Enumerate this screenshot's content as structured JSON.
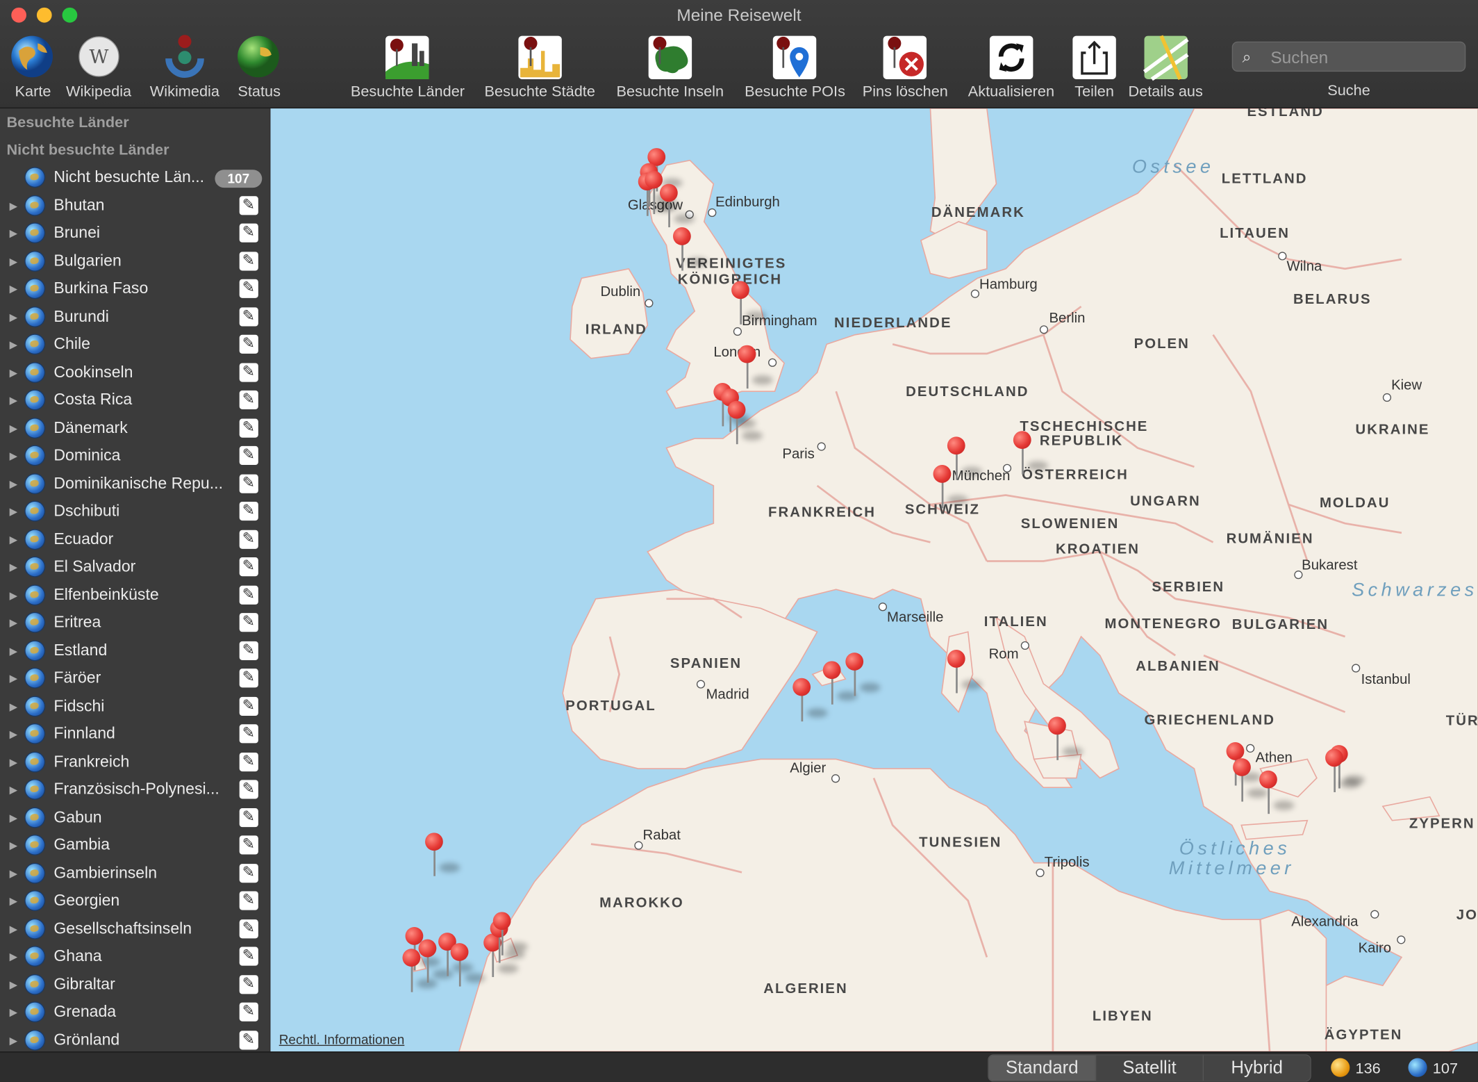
{
  "window": {
    "title": "Meine Reisewelt"
  },
  "toolbar": {
    "left": [
      {
        "label": "Karte",
        "icon": "globe-icon"
      },
      {
        "label": "Wikipedia",
        "icon": "wikipedia-icon"
      },
      {
        "label": "Wikimedia",
        "icon": "wikimedia-icon"
      },
      {
        "label": "Status",
        "icon": "status-globe-icon"
      }
    ],
    "center": [
      {
        "label": "Besuchte Länder",
        "icon": "visited-countries-icon"
      },
      {
        "label": "Besuchte Städte",
        "icon": "visited-cities-icon"
      },
      {
        "label": "Besuchte Inseln",
        "icon": "visited-islands-icon"
      },
      {
        "label": "Besuchte POIs",
        "icon": "visited-pois-icon"
      },
      {
        "label": "Pins löschen",
        "icon": "delete-pins-icon"
      },
      {
        "label": "Aktualisieren",
        "icon": "refresh-icon"
      },
      {
        "label": "Teilen",
        "icon": "share-icon"
      },
      {
        "label": "Details aus",
        "icon": "details-icon"
      }
    ],
    "search": {
      "placeholder": "Suchen",
      "label": "Suche"
    }
  },
  "sidebar": {
    "section_visited": "Besuchte Länder",
    "section_unvisited": "Nicht besuchte Länder",
    "group": {
      "label": "Nicht besuchte Län...",
      "count": "107"
    },
    "items": [
      "Bhutan",
      "Brunei",
      "Bulgarien",
      "Burkina Faso",
      "Burundi",
      "Chile",
      "Cookinseln",
      "Costa Rica",
      "Dänemark",
      "Dominica",
      "Dominikanische Repu...",
      "Dschibuti",
      "Ecuador",
      "El Salvador",
      "Elfenbeinküste",
      "Eritrea",
      "Estland",
      "Färöer",
      "Fidschi",
      "Finnland",
      "Frankreich",
      "Französisch-Polynesi...",
      "Gabun",
      "Gambia",
      "Gambierinseln",
      "Georgien",
      "Gesellschaftsinseln",
      "Ghana",
      "Gibraltar",
      "Grenada",
      "Grönland"
    ]
  },
  "map": {
    "countries": [
      "ESTLAND",
      "LETTLAND",
      "DÄNEMARK",
      "LITAUEN",
      "VEREINIGTES",
      "KÖNIGREICH",
      "BELARUS",
      "IRLAND",
      "NIEDERLANDE",
      "POLEN",
      "DEUTSCHLAND",
      "UKRAINE",
      "TSCHECHISCHE",
      "REPUBLIK",
      "ÖSTERREICH",
      "UNGARN",
      "MOLDAU",
      "FRANKREICH",
      "SCHWEIZ",
      "SLOWENIEN",
      "KROATIEN",
      "RUMÄNIEN",
      "SERBIEN",
      "ITALIEN",
      "MONTENEGRO",
      "BULGARIEN",
      "SPANIEN",
      "ALBANIEN",
      "PORTUGAL",
      "GRIECHENLAND",
      "TÜR",
      "ZYPERN",
      "TUNESIEN",
      "MAROKKO",
      "ALGERIEN",
      "LIBYEN",
      "ÄGYPTEN",
      "JO"
    ],
    "cities": [
      "Edinburgh",
      "Glasgow",
      "Hamburg",
      "Dublin",
      "Berlin",
      "Birmingham",
      "London",
      "Kiew",
      "Paris",
      "München",
      "Wilna",
      "Bukarest",
      "Marseille",
      "Rom",
      "Madrid",
      "Istanbul",
      "Athen",
      "Algier",
      "Rabat",
      "Tripolis",
      "Alexandria",
      "Kairo"
    ],
    "seas": [
      "Ostsee",
      "Schwarzes",
      "Östliches",
      "Mittelmeer"
    ],
    "legal": "Rechtl. Informationen"
  },
  "statusbar": {
    "map_types": [
      "Standard",
      "Satellit",
      "Hybrid"
    ],
    "selected_map_type": "Standard",
    "visited_count": "136",
    "unvisited_count": "107"
  }
}
